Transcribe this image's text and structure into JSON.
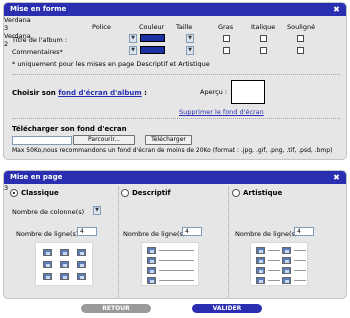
{
  "mise_en_forme": {
    "title": "Mise en forme",
    "headers": {
      "police": "Police",
      "couleur": "Couleur",
      "taille": "Taille",
      "gras": "Gras",
      "italique": "Italique",
      "souligne": "Souligné"
    },
    "rows": [
      {
        "label": "Titre de l'album :",
        "font": "Verdana",
        "color_label": "#1a2fa0",
        "size": "3"
      },
      {
        "label": "Commentaires*",
        "font": "Verdana",
        "color_label": "#1a2fa0",
        "size": "2"
      }
    ],
    "note": "* uniquement pour les mises en page Descriptif et Artistique",
    "choose_bg_prefix": "Choisir son ",
    "choose_bg_link": "fond d'écran d'album",
    "choose_bg_suffix": " :",
    "apercu": "Aperçu :",
    "remove_bg": "Supprimer le fond d'écran",
    "upload_title": "Télécharger son fond d'ecran",
    "parcourir": "Parcourir...",
    "telecharger": "Télécharger",
    "upload_note": "Max 50Ko,nous recommandons un fond d'écran de moins de 20Ko (format : .jpg, .gif, .png, .tif, .psd, .bmp)"
  },
  "mise_en_page": {
    "title": "Mise en page",
    "options": [
      {
        "label": "Classique",
        "selected": true
      },
      {
        "label": "Descriptif",
        "selected": false
      },
      {
        "label": "Artistique",
        "selected": false
      }
    ],
    "colonnes_label": "Nombre de colonne(s)",
    "colonnes_value": "3",
    "lignes_label": "Nombre de ligne(s)",
    "lignes_values": [
      "4",
      "4",
      "4"
    ]
  },
  "footer": {
    "retour": "RETOUR",
    "valider": "VALIDER"
  },
  "colors": {
    "header": "#2a2fb2",
    "panel_bg": "#e6e6e6",
    "retour_btn": "#9a9a9a",
    "valider_btn": "#2a2fb2"
  }
}
